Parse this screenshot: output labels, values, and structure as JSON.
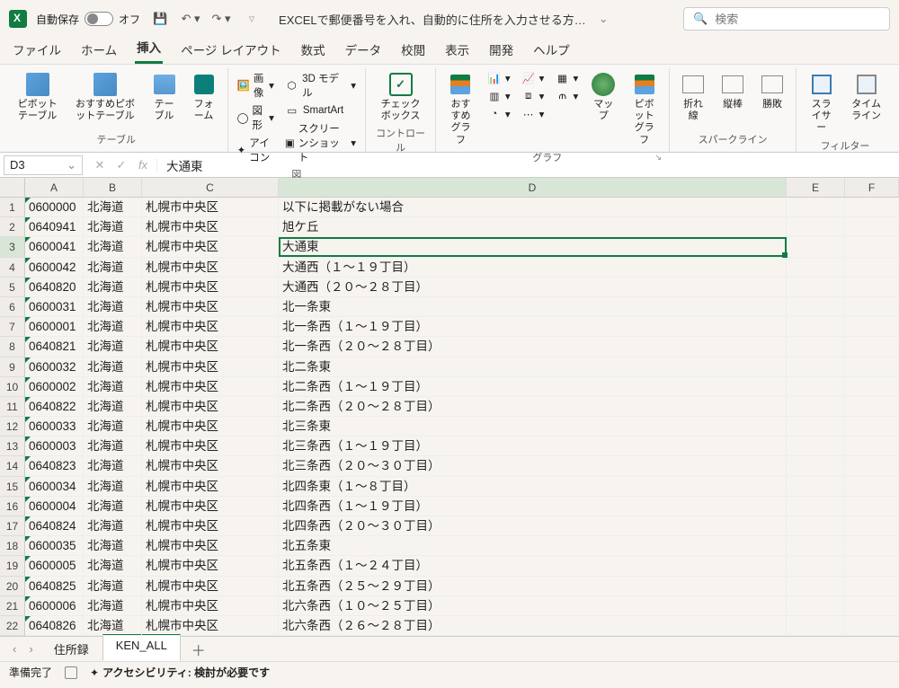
{
  "titlebar": {
    "autosave_label": "自動保存",
    "autosave_state": "オフ",
    "doc_title": "EXCELで郵便番号を入れ、自動的に住所を入力させる方…",
    "search_placeholder": "検索"
  },
  "tabs": [
    "ファイル",
    "ホーム",
    "挿入",
    "ページ レイアウト",
    "数式",
    "データ",
    "校閲",
    "表示",
    "開発",
    "ヘルプ"
  ],
  "active_tab_index": 2,
  "ribbon": {
    "groups": {
      "tables": {
        "label": "テーブル",
        "items": [
          "ピボットテーブル",
          "おすすめピボットテーブル",
          "テーブル",
          "フォーム"
        ]
      },
      "illustrations": {
        "label": "図",
        "items": [
          "画像",
          "3D モデル",
          "図形",
          "SmartArt",
          "アイコン",
          "スクリーンショット"
        ]
      },
      "controls": {
        "label": "コントロール",
        "items": [
          "チェックボックス"
        ]
      },
      "charts": {
        "label": "グラフ",
        "recommended": "おすすめグラフ",
        "map": "マップ",
        "pivotchart": "ピボットグラフ"
      },
      "sparklines": {
        "label": "スパークライン",
        "items": [
          "折れ線",
          "縦棒",
          "勝敗"
        ]
      },
      "filters": {
        "label": "フィルター",
        "items": [
          "スライサー",
          "タイムライン"
        ]
      }
    }
  },
  "namebox": "D3",
  "formula": "大通東",
  "columns": [
    "A",
    "B",
    "C",
    "D",
    "E",
    "F"
  ],
  "selected_cell": {
    "row": 3,
    "col": "D"
  },
  "rows": [
    {
      "n": 1,
      "A": "0600000",
      "B": "北海道",
      "C": "札幌市中央区",
      "D": "以下に掲載がない場合"
    },
    {
      "n": 2,
      "A": "0640941",
      "B": "北海道",
      "C": "札幌市中央区",
      "D": "旭ケ丘"
    },
    {
      "n": 3,
      "A": "0600041",
      "B": "北海道",
      "C": "札幌市中央区",
      "D": "大通東"
    },
    {
      "n": 4,
      "A": "0600042",
      "B": "北海道",
      "C": "札幌市中央区",
      "D": "大通西（１～１９丁目）"
    },
    {
      "n": 5,
      "A": "0640820",
      "B": "北海道",
      "C": "札幌市中央区",
      "D": "大通西（２０～２８丁目）"
    },
    {
      "n": 6,
      "A": "0600031",
      "B": "北海道",
      "C": "札幌市中央区",
      "D": "北一条東"
    },
    {
      "n": 7,
      "A": "0600001",
      "B": "北海道",
      "C": "札幌市中央区",
      "D": "北一条西（１～１９丁目）"
    },
    {
      "n": 8,
      "A": "0640821",
      "B": "北海道",
      "C": "札幌市中央区",
      "D": "北一条西（２０～２８丁目）"
    },
    {
      "n": 9,
      "A": "0600032",
      "B": "北海道",
      "C": "札幌市中央区",
      "D": "北二条東"
    },
    {
      "n": 10,
      "A": "0600002",
      "B": "北海道",
      "C": "札幌市中央区",
      "D": "北二条西（１～１９丁目）"
    },
    {
      "n": 11,
      "A": "0640822",
      "B": "北海道",
      "C": "札幌市中央区",
      "D": "北二条西（２０～２８丁目）"
    },
    {
      "n": 12,
      "A": "0600033",
      "B": "北海道",
      "C": "札幌市中央区",
      "D": "北三条東"
    },
    {
      "n": 13,
      "A": "0600003",
      "B": "北海道",
      "C": "札幌市中央区",
      "D": "北三条西（１～１９丁目）"
    },
    {
      "n": 14,
      "A": "0640823",
      "B": "北海道",
      "C": "札幌市中央区",
      "D": "北三条西（２０～３０丁目）"
    },
    {
      "n": 15,
      "A": "0600034",
      "B": "北海道",
      "C": "札幌市中央区",
      "D": "北四条東（１～８丁目）"
    },
    {
      "n": 16,
      "A": "0600004",
      "B": "北海道",
      "C": "札幌市中央区",
      "D": "北四条西（１～１９丁目）"
    },
    {
      "n": 17,
      "A": "0640824",
      "B": "北海道",
      "C": "札幌市中央区",
      "D": "北四条西（２０～３０丁目）"
    },
    {
      "n": 18,
      "A": "0600035",
      "B": "北海道",
      "C": "札幌市中央区",
      "D": "北五条東"
    },
    {
      "n": 19,
      "A": "0600005",
      "B": "北海道",
      "C": "札幌市中央区",
      "D": "北五条西（１～２４丁目）"
    },
    {
      "n": 20,
      "A": "0640825",
      "B": "北海道",
      "C": "札幌市中央区",
      "D": "北五条西（２５～２９丁目）"
    },
    {
      "n": 21,
      "A": "0600006",
      "B": "北海道",
      "C": "札幌市中央区",
      "D": "北六条西（１０～２５丁目）"
    },
    {
      "n": 22,
      "A": "0640826",
      "B": "北海道",
      "C": "札幌市中央区",
      "D": "北六条西（２６～２８丁目）"
    }
  ],
  "sheet_tabs": [
    "住所録",
    "KEN_ALL"
  ],
  "active_sheet_index": 1,
  "statusbar": {
    "ready": "準備完了",
    "accessibility": "アクセシビリティ: 検討が必要です"
  }
}
